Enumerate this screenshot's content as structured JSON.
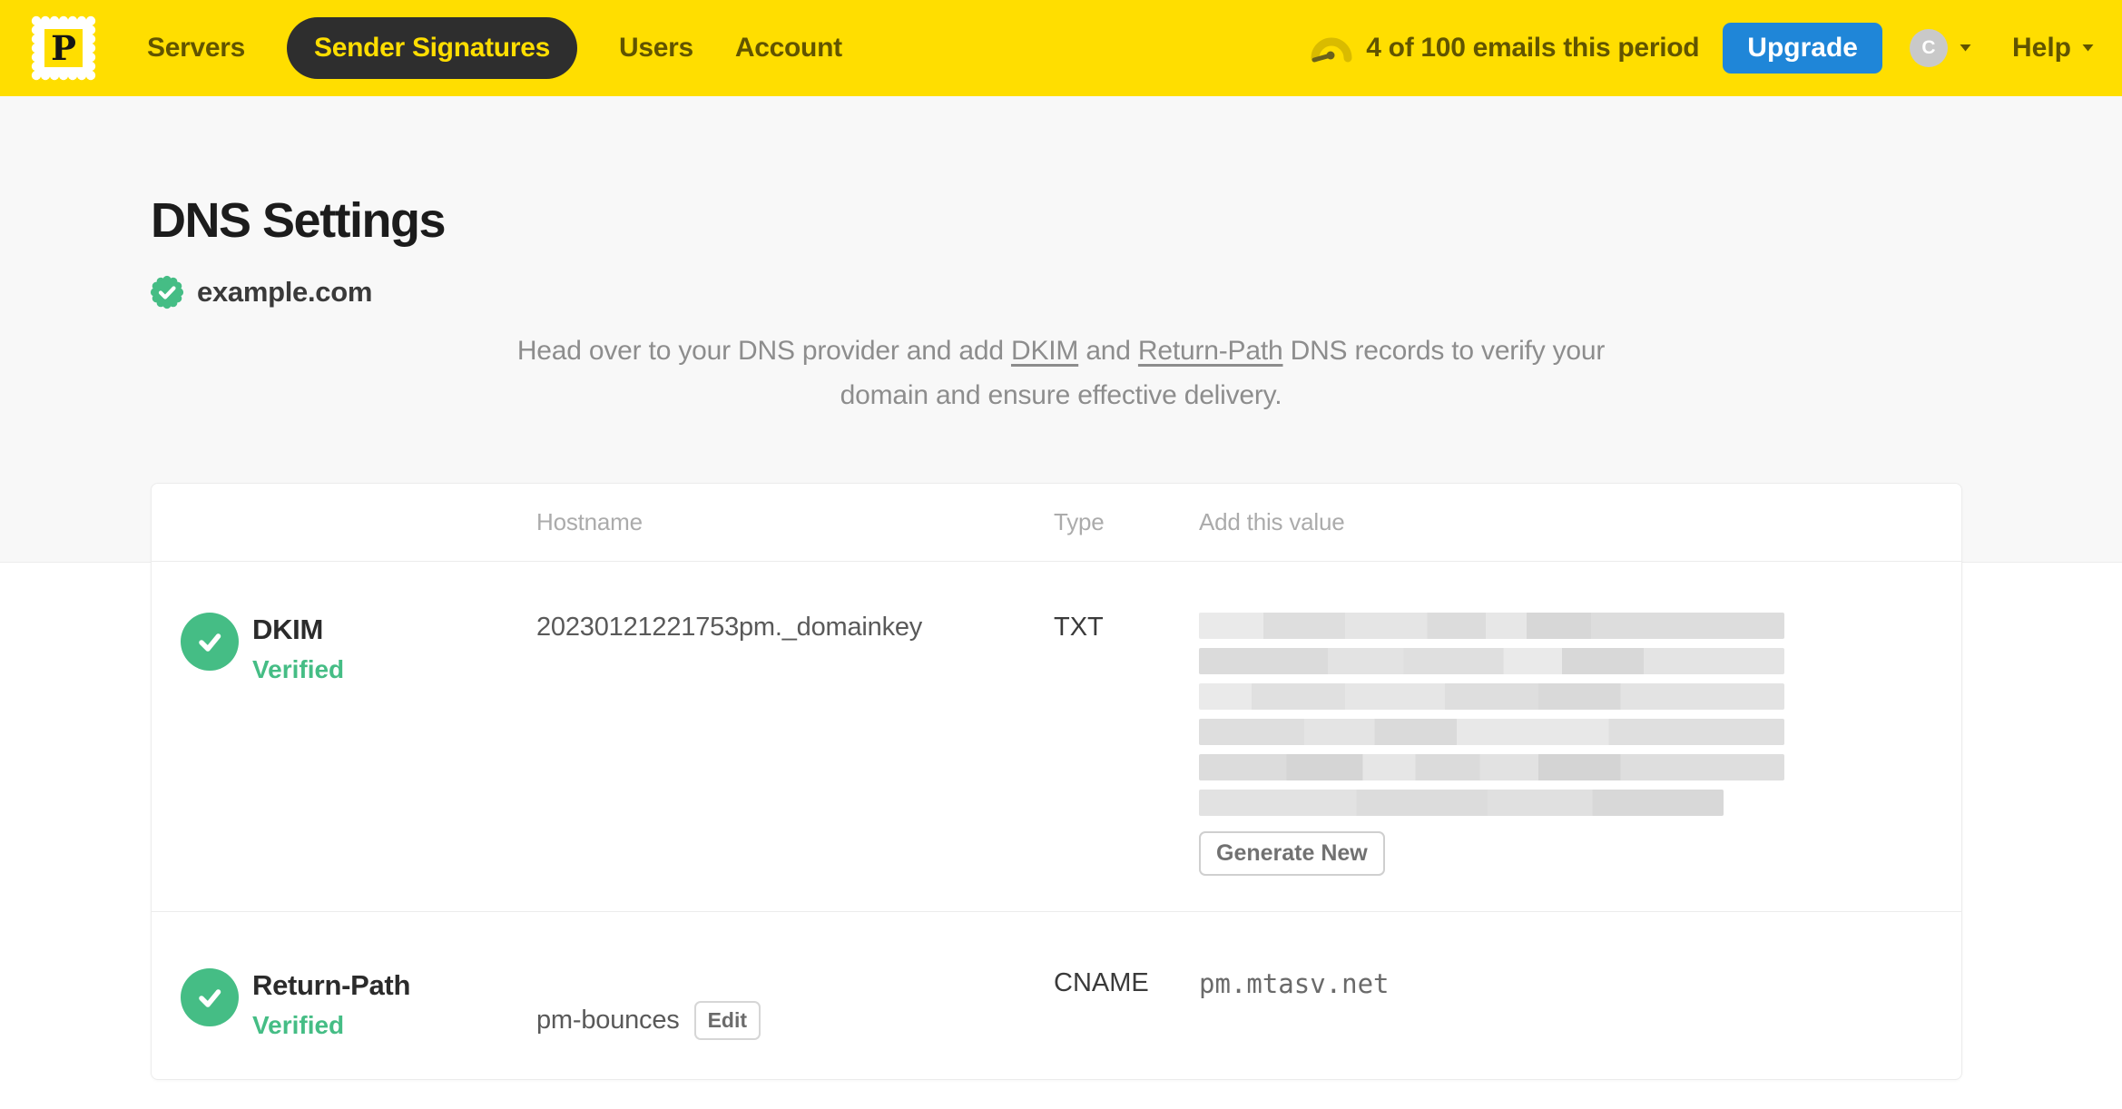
{
  "nav": {
    "logo_letter": "P",
    "items": [
      {
        "label": "Servers",
        "active": false
      },
      {
        "label": "Sender Signatures",
        "active": true
      },
      {
        "label": "Users",
        "active": false
      },
      {
        "label": "Account",
        "active": false
      }
    ],
    "usage_text": "4 of 100 emails this period",
    "upgrade_label": "Upgrade",
    "avatar_initial": "C",
    "help_label": "Help"
  },
  "page": {
    "title": "DNS Settings",
    "domain": "example.com",
    "description": {
      "before_dkim": "Head over to your DNS provider and add ",
      "dkim_link": "DKIM",
      "between_links": " and ",
      "return_path_link": "Return-Path",
      "after_links": " DNS records to verify your domain and ensure effective delivery."
    }
  },
  "table": {
    "headers": {
      "hostname": "Hostname",
      "type": "Type",
      "value": "Add this value"
    },
    "rows": [
      {
        "name": "DKIM",
        "status": "Verified",
        "hostname": "20230121221753pm._domainkey",
        "type": "TXT",
        "value_redacted": true,
        "value_bars": [
          645,
          645,
          645,
          645,
          645,
          578
        ],
        "action_label": "Generate New"
      },
      {
        "name": "Return-Path",
        "status": "Verified",
        "hostname": "pm-bounces",
        "edit_label": "Edit",
        "type": "CNAME",
        "value": "pm.mtasv.net"
      }
    ]
  },
  "colors": {
    "brand_yellow": "#ffde00",
    "nav_pill_dark": "#2e2e2e",
    "upgrade_blue": "#1f86d8",
    "verified_green": "#45bd85",
    "avatar_gray": "#c9c9c9"
  }
}
